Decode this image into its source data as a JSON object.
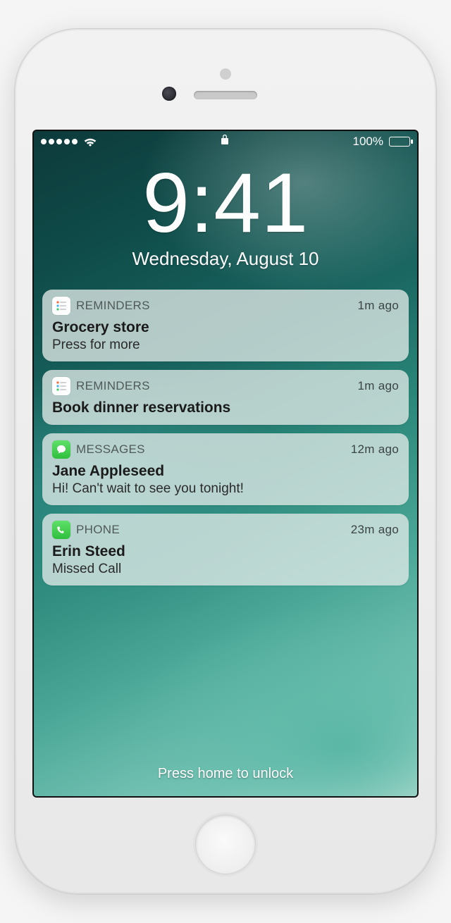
{
  "status": {
    "battery_label": "100%"
  },
  "clock": {
    "time": "9:41",
    "date": "Wednesday, August 10"
  },
  "notifications": [
    {
      "app": "REMINDERS",
      "icon": "reminders",
      "ago": "1m ago",
      "title": "Grocery store",
      "subtitle": "Press for more"
    },
    {
      "app": "REMINDERS",
      "icon": "reminders",
      "ago": "1m ago",
      "title": "Book dinner reservations",
      "subtitle": ""
    },
    {
      "app": "MESSAGES",
      "icon": "messages",
      "ago": "12m ago",
      "title": "Jane Appleseed",
      "subtitle": "Hi! Can't wait to see you tonight!"
    },
    {
      "app": "PHONE",
      "icon": "phone",
      "ago": "23m ago",
      "title": "Erin Steed",
      "subtitle": "Missed Call"
    }
  ],
  "unlock_hint": "Press home to unlock"
}
